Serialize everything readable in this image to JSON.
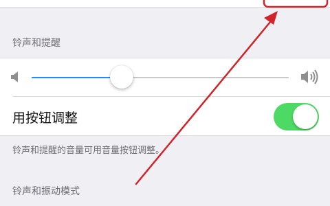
{
  "sections": {
    "ringer_header": "铃声和提醒",
    "vibrate_header": "铃声和振动模式"
  },
  "ringer": {
    "volume_level": 0.35,
    "change_with_buttons_label": "用按钮调整",
    "change_with_buttons_on": true,
    "footnote": "铃声和提醒的音量可用音量按钮调整。"
  },
  "icons": {
    "volume_low": "speaker-low-icon",
    "volume_high": "speaker-high-icon"
  },
  "colors": {
    "toggle_on": "#4cd964",
    "slider_fill": "#1e8cff",
    "annotation": "#d0242a"
  }
}
